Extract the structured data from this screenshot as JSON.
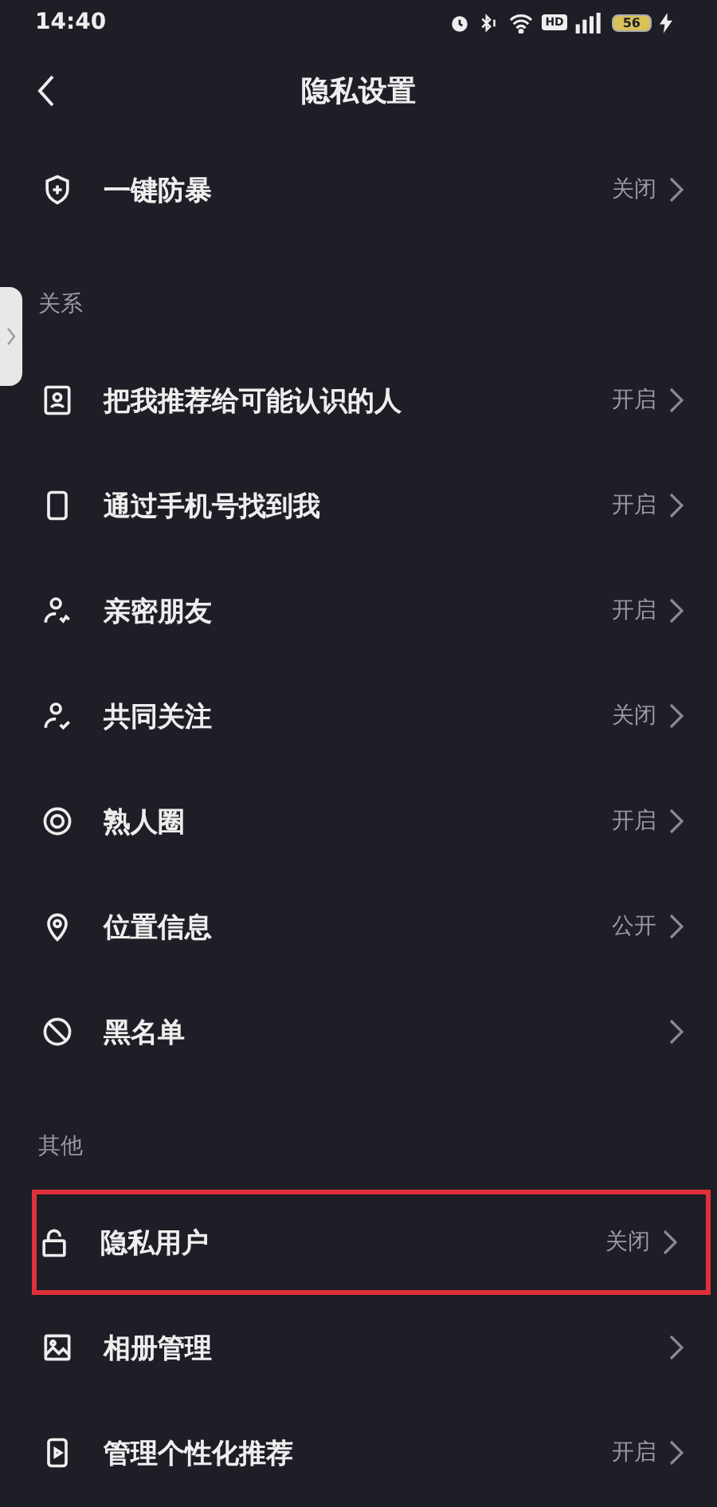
{
  "status_bar": {
    "time": "14:40",
    "hd_badge": "HD",
    "battery": "56"
  },
  "nav": {
    "title": "隐私设置"
  },
  "top_items": [
    {
      "label": "一键防暴",
      "value": "关闭",
      "highlighted": false
    }
  ],
  "sections": [
    {
      "title": "关系",
      "items": [
        {
          "label": "把我推荐给可能认识的人",
          "value": "开启",
          "highlighted": false
        },
        {
          "label": "通过手机号找到我",
          "value": "开启",
          "highlighted": false
        },
        {
          "label": "亲密朋友",
          "value": "开启",
          "highlighted": false
        },
        {
          "label": "共同关注",
          "value": "关闭",
          "highlighted": false
        },
        {
          "label": "熟人圈",
          "value": "开启",
          "highlighted": false
        },
        {
          "label": "位置信息",
          "value": "公开",
          "highlighted": false
        },
        {
          "label": "黑名单",
          "highlighted": false
        }
      ]
    },
    {
      "title": "其他",
      "items": [
        {
          "label": "隐私用户",
          "value": "关闭",
          "highlighted": true
        },
        {
          "label": "相册管理",
          "highlighted": false
        },
        {
          "label": "管理个性化推荐",
          "value": "开启",
          "highlighted": false
        }
      ]
    }
  ]
}
